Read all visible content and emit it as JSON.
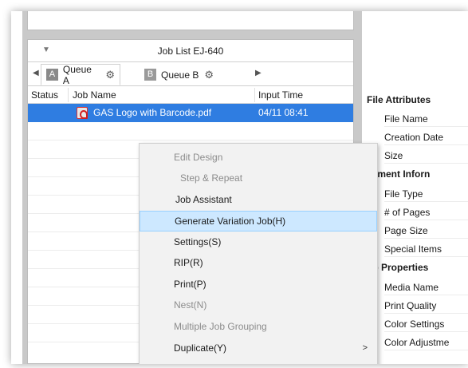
{
  "panel": {
    "title": "Job List EJ-640",
    "tabs": [
      {
        "letter": "A",
        "label": "Queue A"
      },
      {
        "letter": "B",
        "label": "Queue B"
      }
    ],
    "columns": {
      "status": "Status",
      "name": "Job Name",
      "time": "Input Time"
    },
    "rows": [
      {
        "name": "GAS Logo with Barcode.pdf",
        "time": "04/11 08:41",
        "selected": true
      }
    ]
  },
  "context_menu": {
    "items": [
      {
        "label": "Edit Design",
        "disabled": true
      },
      {
        "label": "Step & Repeat",
        "disabled": true
      },
      {
        "label": "Job Assistant",
        "disabled": false
      },
      {
        "label": "Generate Variation Job(H)",
        "disabled": false,
        "highlight": true
      },
      {
        "label": "Settings(S)",
        "disabled": false
      },
      {
        "label": "RIP(R)",
        "disabled": false
      },
      {
        "label": "Print(P)",
        "disabled": false
      },
      {
        "label": "Nest(N)",
        "disabled": true
      },
      {
        "label": "Multiple Job Grouping",
        "disabled": true
      },
      {
        "label": "Duplicate(Y)",
        "disabled": false,
        "submenu": ">"
      }
    ]
  },
  "attributes": {
    "sections": [
      {
        "title": "File Attributes",
        "items": [
          "File Name",
          "Creation Date",
          "Size"
        ]
      },
      {
        "title": "ocument Inforn",
        "items": [
          "File Type",
          "# of Pages",
          "Page Size",
          "Special Items"
        ]
      },
      {
        "title": "ob Properties",
        "items": [
          "Media Name",
          "Print Quality",
          "Color Settings",
          "Color Adjustme"
        ]
      }
    ]
  },
  "colors": {
    "selection": "#2f7de1",
    "menu_highlight": "#cde8ff",
    "frame": "#c9c9c9"
  }
}
